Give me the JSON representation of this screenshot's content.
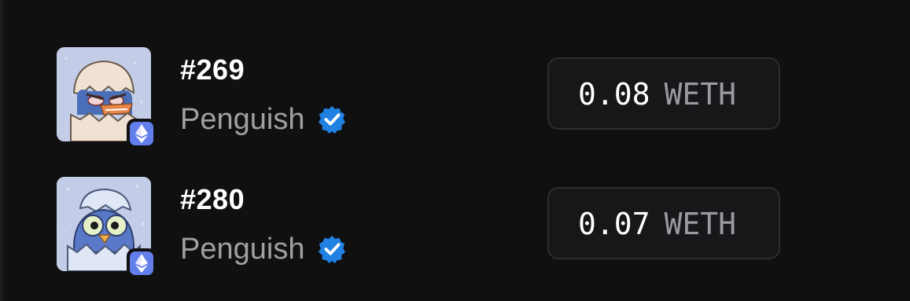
{
  "items": [
    {
      "token_title": "#269",
      "collection": "Penguish",
      "verified_icon": "verified-badge-icon",
      "chain_icon": "ethereum-icon",
      "price_value": "0.08",
      "price_unit": "WETH",
      "colors": {
        "shell": "#f2e6d6",
        "bird": "#4a6fb8",
        "bg": "#c3cde8"
      }
    },
    {
      "token_title": "#280",
      "collection": "Penguish",
      "verified_icon": "verified-badge-icon",
      "chain_icon": "ethereum-icon",
      "price_value": "0.07",
      "price_unit": "WETH",
      "colors": {
        "shell": "#cfdcf2",
        "bird": "#5a78c8",
        "bg": "#c3cde8"
      }
    }
  ],
  "theme": {
    "background": "#101011",
    "verified_blue": "#2081e2",
    "eth_purple": "#627eea"
  }
}
